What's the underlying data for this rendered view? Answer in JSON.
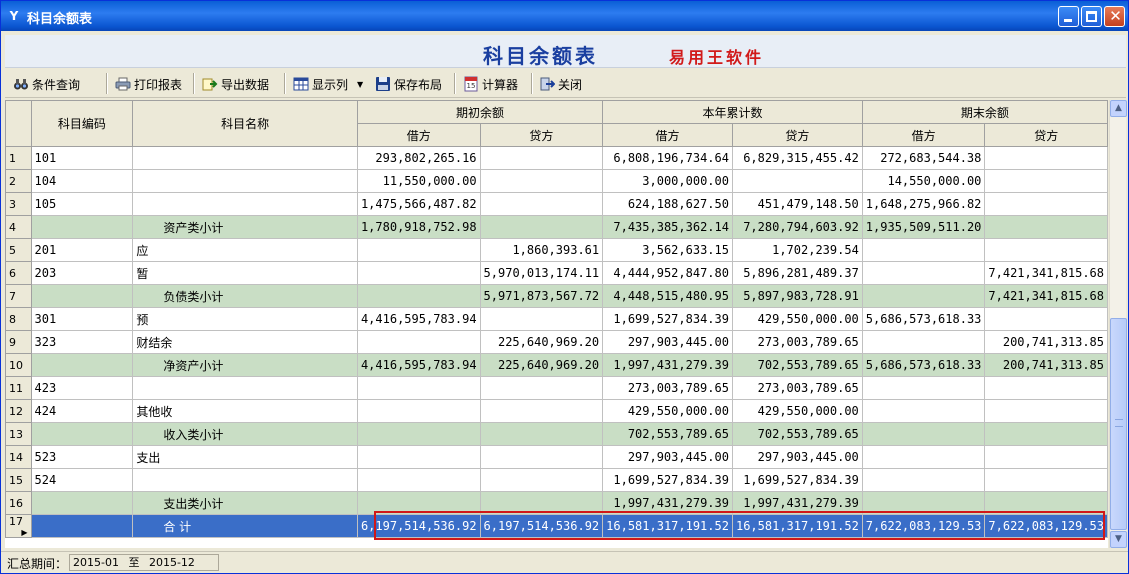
{
  "window": {
    "title": "科目余额表"
  },
  "banner": {
    "title": "科目余额表",
    "brand": "易用王软件"
  },
  "toolbar": {
    "items": [
      {
        "label": "条件查询",
        "icon": "binoculars-icon"
      },
      {
        "label": "打印报表",
        "icon": "printer-icon"
      },
      {
        "label": "导出数据",
        "icon": "export-icon"
      },
      {
        "label": "显示列",
        "icon": "columns-icon"
      },
      {
        "label": "保存布局",
        "icon": "save-icon"
      },
      {
        "label": "计算器",
        "icon": "calculator-icon"
      },
      {
        "label": "关闭",
        "icon": "exit-icon"
      }
    ]
  },
  "table": {
    "group_headers": {
      "code": "科目编码",
      "name": "科目名称",
      "opening": "期初余额",
      "ytd": "本年累计数",
      "closing": "期末余额"
    },
    "sub_headers": {
      "debit": "借方",
      "credit": "贷方"
    },
    "rows": [
      {
        "n": "1",
        "code": "101",
        "name": "",
        "od": "293,802,265.16",
        "oc": "",
        "yd": "6,808,196,734.64",
        "yc": "6,829,315,455.42",
        "cd": "272,683,544.38",
        "cc": "",
        "kind": "normal"
      },
      {
        "n": "2",
        "code": "104",
        "name": "",
        "od": "11,550,000.00",
        "oc": "",
        "yd": "3,000,000.00",
        "yc": "",
        "cd": "14,550,000.00",
        "cc": "",
        "kind": "normal"
      },
      {
        "n": "3",
        "code": "105",
        "name": "",
        "od": "1,475,566,487.82",
        "oc": "",
        "yd": "624,188,627.50",
        "yc": "451,479,148.50",
        "cd": "1,648,275,966.82",
        "cc": "",
        "kind": "normal"
      },
      {
        "n": "4",
        "code": "",
        "name": "资产类小计",
        "od": "1,780,918,752.98",
        "oc": "",
        "yd": "7,435,385,362.14",
        "yc": "7,280,794,603.92",
        "cd": "1,935,509,511.20",
        "cc": "",
        "kind": "sub"
      },
      {
        "n": "5",
        "code": "201",
        "name": "应",
        "od": "",
        "oc": "1,860,393.61",
        "yd": "3,562,633.15",
        "yc": "1,702,239.54",
        "cd": "",
        "cc": "",
        "kind": "normal"
      },
      {
        "n": "6",
        "code": "203",
        "name": "暂",
        "od": "",
        "oc": "5,970,013,174.11",
        "yd": "4,444,952,847.80",
        "yc": "5,896,281,489.37",
        "cd": "",
        "cc": "7,421,341,815.68",
        "kind": "normal"
      },
      {
        "n": "7",
        "code": "",
        "name": "负债类小计",
        "od": "",
        "oc": "5,971,873,567.72",
        "yd": "4,448,515,480.95",
        "yc": "5,897,983,728.91",
        "cd": "",
        "cc": "7,421,341,815.68",
        "kind": "sub"
      },
      {
        "n": "8",
        "code": "301",
        "name": "预",
        "od": "4,416,595,783.94",
        "oc": "",
        "yd": "1,699,527,834.39",
        "yc": "429,550,000.00",
        "cd": "5,686,573,618.33",
        "cc": "",
        "kind": "normal"
      },
      {
        "n": "9",
        "code": "323",
        "name": "财结余",
        "od": "",
        "oc": "225,640,969.20",
        "yd": "297,903,445.00",
        "yc": "273,003,789.65",
        "cd": "",
        "cc": "200,741,313.85",
        "kind": "normal"
      },
      {
        "n": "10",
        "code": "",
        "name": "净资产小计",
        "od": "4,416,595,783.94",
        "oc": "225,640,969.20",
        "yd": "1,997,431,279.39",
        "yc": "702,553,789.65",
        "cd": "5,686,573,618.33",
        "cc": "200,741,313.85",
        "kind": "sub"
      },
      {
        "n": "11",
        "code": "423",
        "name": "",
        "od": "",
        "oc": "",
        "yd": "273,003,789.65",
        "yc": "273,003,789.65",
        "cd": "",
        "cc": "",
        "kind": "normal"
      },
      {
        "n": "12",
        "code": "424",
        "name": "其他收",
        "od": "",
        "oc": "",
        "yd": "429,550,000.00",
        "yc": "429,550,000.00",
        "cd": "",
        "cc": "",
        "kind": "normal"
      },
      {
        "n": "13",
        "code": "",
        "name": "收入类小计",
        "od": "",
        "oc": "",
        "yd": "702,553,789.65",
        "yc": "702,553,789.65",
        "cd": "",
        "cc": "",
        "kind": "sub"
      },
      {
        "n": "14",
        "code": "523",
        "name": "支出",
        "od": "",
        "oc": "",
        "yd": "297,903,445.00",
        "yc": "297,903,445.00",
        "cd": "",
        "cc": "",
        "kind": "normal"
      },
      {
        "n": "15",
        "code": "524",
        "name": "",
        "od": "",
        "oc": "",
        "yd": "1,699,527,834.39",
        "yc": "1,699,527,834.39",
        "cd": "",
        "cc": "",
        "kind": "normal"
      },
      {
        "n": "16",
        "code": "",
        "name": "支出类小计",
        "od": "",
        "oc": "",
        "yd": "1,997,431,279.39",
        "yc": "1,997,431,279.39",
        "cd": "",
        "cc": "",
        "kind": "sub"
      },
      {
        "n": "17",
        "code": "",
        "name": "合 计",
        "od": "6,197,514,536.92",
        "oc": "6,197,514,536.92",
        "yd": "16,581,317,191.52",
        "yc": "16,581,317,191.52",
        "cd": "7,622,083,129.53",
        "cc": "7,622,083,129.53",
        "kind": "total"
      }
    ]
  },
  "status": {
    "label": "汇总期间：",
    "from": "2015-01",
    "to_word": "至",
    "to": "2015-12"
  },
  "colors": {
    "subtotal_row": "#c9dec5",
    "total_row": "#3a6ec8",
    "highlight_border": "#d01818",
    "banner_title": "#1a3fa0",
    "brand": "#d11a1a"
  }
}
